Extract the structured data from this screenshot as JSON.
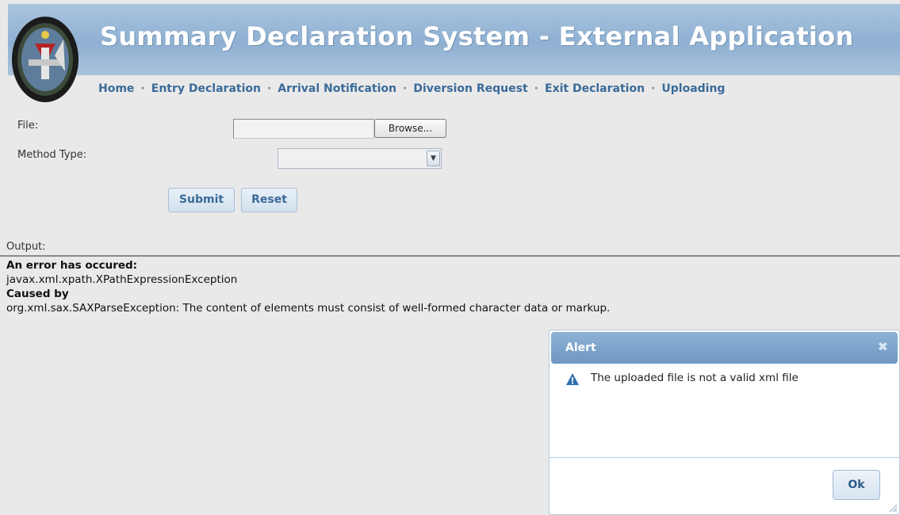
{
  "header": {
    "title": "Summary Declaration System - External Application",
    "logo_icon": "customs-crest-icon"
  },
  "nav": {
    "items": [
      "Home",
      "Entry Declaration",
      "Arrival Notification",
      "Diversion Request",
      "Exit Declaration",
      "Uploading"
    ],
    "separator": "·"
  },
  "form": {
    "file_label": "File:",
    "file_value": "",
    "browse_label": "Browse...",
    "method_label": "Method Type:",
    "method_value": "",
    "submit_label": "Submit",
    "reset_label": "Reset"
  },
  "output": {
    "label": "Output:",
    "error_heading": "An error has occured:",
    "exception": "javax.xml.xpath.XPathExpressionException",
    "caused_by": "Caused by",
    "cause_detail": "org.xml.sax.SAXParseException: The content of elements must consist of well-formed character data or markup."
  },
  "alert": {
    "title": "Alert",
    "message": "The uploaded file is not a valid xml file",
    "ok_label": "Ok",
    "icon": "warning-icon"
  },
  "colors": {
    "banner": "#8fb0d2",
    "nav_text": "#3a6a99",
    "dialog_title": "#7fa5cc"
  }
}
